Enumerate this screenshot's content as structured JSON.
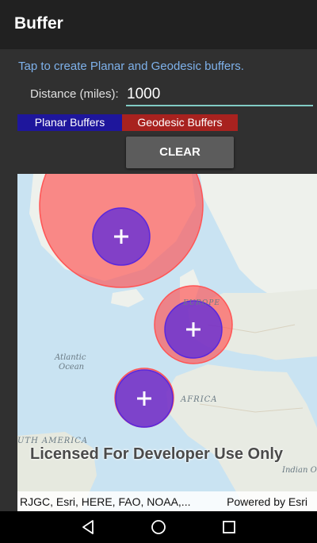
{
  "app": {
    "title": "Buffer"
  },
  "instructions": "Tap to create Planar and Geodesic buffers.",
  "distance": {
    "label": "Distance (miles):",
    "value": "1000"
  },
  "legend": {
    "planar": "Planar Buffers",
    "geodesic": "Geodesic Buffers"
  },
  "clear_button": "CLEAR",
  "map": {
    "labels": {
      "europe": "EUROPE",
      "africa": "AFRICA",
      "atlantic": "Atlantic",
      "ocean": "Ocean",
      "south_america": "UTH AMERICA",
      "indian": "Indian O"
    },
    "license": "Licensed For Developer Use Only",
    "attribution": "RJGC, Esri, HERE, FAO, NOAA,...",
    "powered_by": "Powered by Esri"
  },
  "colors": {
    "planar": "#1e169c",
    "geodesic": "#a8221f",
    "instructions": "#7eb1ea",
    "input_underline": "#80cbc4"
  },
  "icons": [
    "plus-icon",
    "back-icon",
    "home-icon",
    "recents-icon"
  ]
}
